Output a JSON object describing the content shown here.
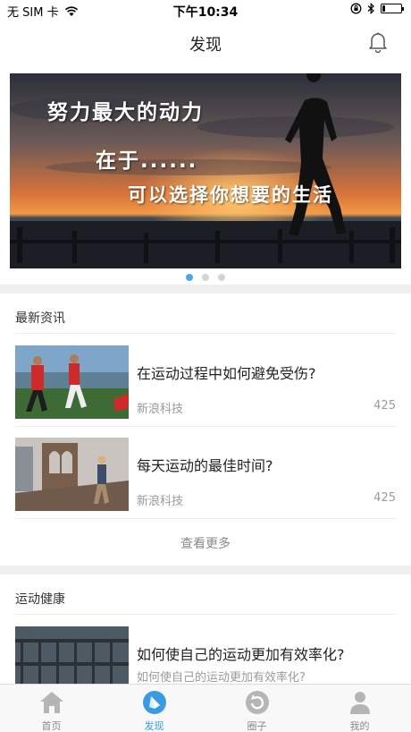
{
  "status_bar": {
    "carrier": "无 SIM 卡",
    "time": "下午10:34",
    "battery_level": 0.15
  },
  "nav": {
    "title": "发现",
    "right_icon": "bell-icon"
  },
  "banner": {
    "line1": "努力最大的动力",
    "line2": "在于......",
    "line3": "可以选择你想要的生活",
    "page_count": 3,
    "active_page": 1
  },
  "sections": [
    {
      "title": "最新资讯",
      "items": [
        {
          "title": "在运动过程中如何避免受伤?",
          "source": "新浪科技",
          "count": "425"
        },
        {
          "title": "每天运动的最佳时间?",
          "source": "新浪科技",
          "count": "425"
        }
      ],
      "more_label": "查看更多"
    },
    {
      "title": "运动健康",
      "items": [
        {
          "title": "如何使自己的运动更加有效率化?",
          "subtitle": "如何使自己的运动更加有效率化?"
        }
      ]
    }
  ],
  "tabs": [
    {
      "label": "首页",
      "icon": "home-icon",
      "active": false
    },
    {
      "label": "发现",
      "icon": "compass-icon",
      "active": true
    },
    {
      "label": "圈子",
      "icon": "circle-refresh-icon",
      "active": false
    },
    {
      "label": "我的",
      "icon": "person-icon",
      "active": false
    }
  ],
  "colors": {
    "accent": "#3b9be0",
    "inactive": "#b5b5b5"
  }
}
